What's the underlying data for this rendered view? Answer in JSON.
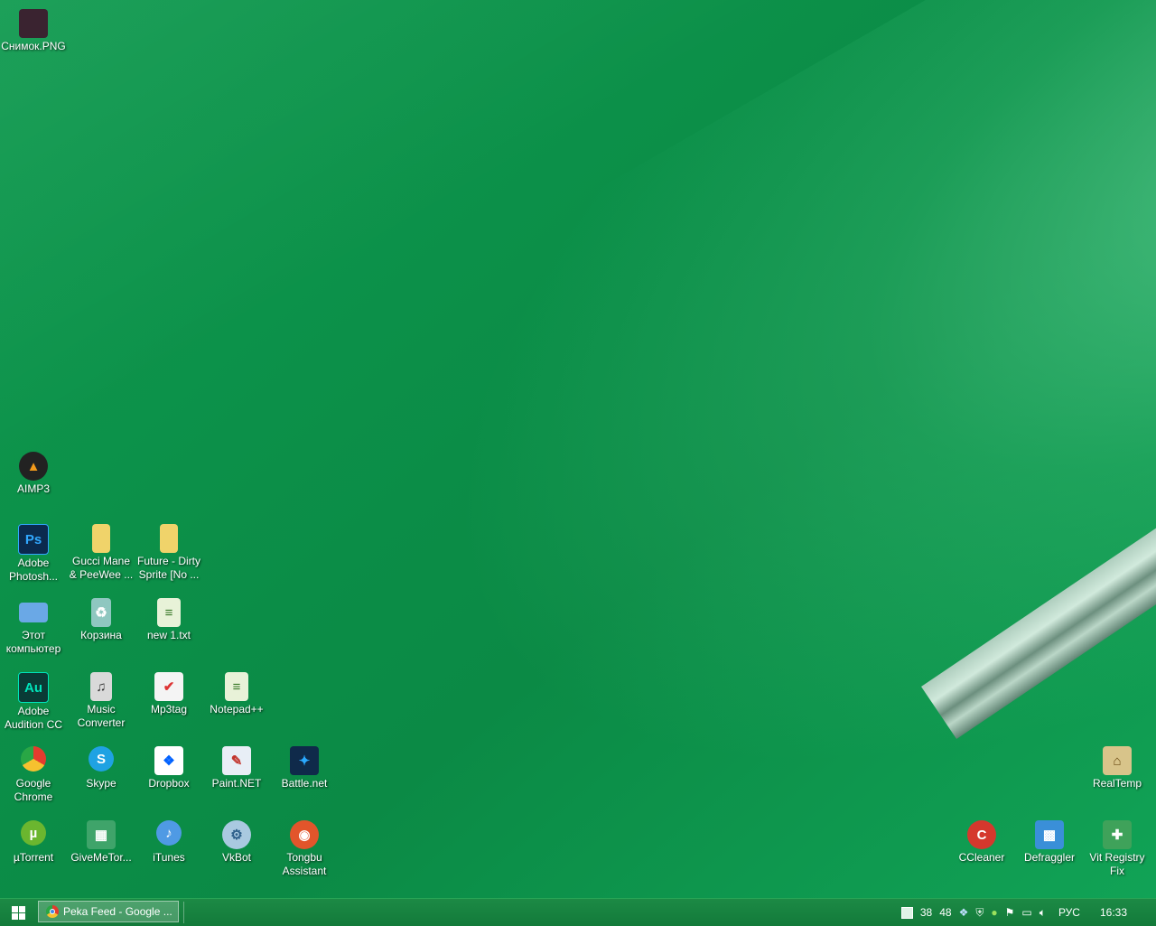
{
  "desktop": {
    "icons": [
      {
        "label": "Снимок.PNG",
        "glyph": "▪",
        "color": "#3a2330"
      },
      {
        "label": "AIMP3",
        "glyph": "▲",
        "color": "#f29a1b"
      },
      {
        "label": "Adobe\nPhotosh...",
        "glyph": "Ps",
        "color": "#0b2a4e"
      },
      {
        "label": "Gucci Mane\n& PeeWee ...",
        "glyph": "▮",
        "color": "#f0d36a"
      },
      {
        "label": "Future - Dirty\nSprite [No ...",
        "glyph": "▮",
        "color": "#f0d36a"
      },
      {
        "label": "Этот\nкомпьютер",
        "glyph": "▭",
        "color": "#6aa8e6"
      },
      {
        "label": "Корзина",
        "glyph": "♻",
        "color": "#8fc7c0"
      },
      {
        "label": "new 1.txt",
        "glyph": "≡",
        "color": "#e8f2d8"
      },
      {
        "label": "Adobe\nAudition CC",
        "glyph": "Au",
        "color": "#0a3b36"
      },
      {
        "label": "Music\nConverter",
        "glyph": "♫",
        "color": "#d9d9d9"
      },
      {
        "label": "Mp3tag",
        "glyph": "✔",
        "color": "#f4f4f4"
      },
      {
        "label": "Notepad++",
        "glyph": "≡",
        "color": "#e8f2d8"
      },
      {
        "label": "Google\nChrome",
        "glyph": "●",
        "color": "#e33b2e"
      },
      {
        "label": "Skype",
        "glyph": "S",
        "color": "#1fa2e3"
      },
      {
        "label": "Dropbox",
        "glyph": "❖",
        "color": "#ffffff"
      },
      {
        "label": "Paint.NET",
        "glyph": "✎",
        "color": "#e8eef6"
      },
      {
        "label": "Battle.net",
        "glyph": "✦",
        "color": "#0f2a4a"
      },
      {
        "label": "µTorrent",
        "glyph": "µ",
        "color": "#6bb62f"
      },
      {
        "label": "GiveMeTor...",
        "glyph": "▦",
        "color": "#3fa46a"
      },
      {
        "label": "iTunes",
        "glyph": "♪",
        "color": "#4f9ae4"
      },
      {
        "label": "VkBot",
        "glyph": "⚙",
        "color": "#a9c9e0"
      },
      {
        "label": "Tongbu\nAssistant",
        "glyph": "◉",
        "color": "#e2552b"
      },
      {
        "label": "RealTemp",
        "glyph": "⌂",
        "color": "#d8c48a"
      },
      {
        "label": "CCleaner",
        "glyph": "C",
        "color": "#d5382d"
      },
      {
        "label": "Defraggler",
        "glyph": "▩",
        "color": "#3a8fd8"
      },
      {
        "label": "Vit Registry\nFix",
        "glyph": "✚",
        "color": "#3fa25a"
      }
    ]
  },
  "taskbar": {
    "active_window_label": "Peka Feed - Google ...",
    "tray": {
      "temp1": "38",
      "temp2": "48",
      "language": "РУС",
      "clock": "16:33"
    }
  }
}
